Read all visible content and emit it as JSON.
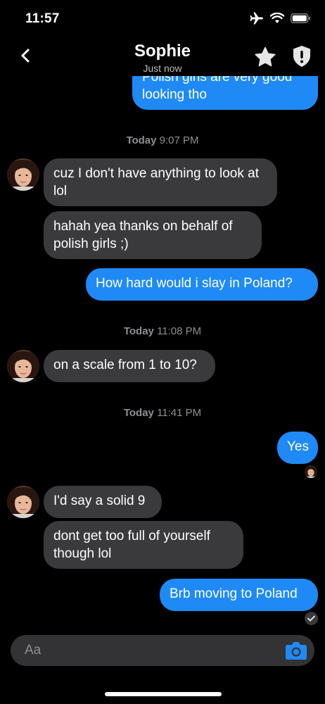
{
  "status_bar": {
    "time": "11:57"
  },
  "header": {
    "contact_name": "Sophie",
    "contact_status": "Just now"
  },
  "messages": [
    {
      "type": "outgoing",
      "text": "Polish girls are very good looking tho"
    },
    {
      "type": "timestamp",
      "day": "Today",
      "time": "9:07 PM"
    },
    {
      "type": "incoming",
      "text": "cuz I don't have anything to look at lol"
    },
    {
      "type": "incoming",
      "text": "hahah yea thanks on behalf of polish girls ;)"
    },
    {
      "type": "outgoing",
      "text": "How hard would i slay in Poland?"
    },
    {
      "type": "timestamp",
      "day": "Today",
      "time": "11:08 PM"
    },
    {
      "type": "incoming",
      "text": "on a scale from 1 to 10?"
    },
    {
      "type": "timestamp",
      "day": "Today",
      "time": "11:41 PM"
    },
    {
      "type": "outgoing",
      "text": "Yes"
    },
    {
      "type": "incoming",
      "text": "I'd say a solid 9"
    },
    {
      "type": "incoming",
      "text": "dont get too full of yourself though lol"
    },
    {
      "type": "outgoing",
      "text": "Brb moving to Poland"
    }
  ],
  "composer": {
    "placeholder": "Aa"
  },
  "colors": {
    "outgoing_bubble": "#1f8af6",
    "incoming_bubble": "#3a3a3c",
    "background": "#000000"
  },
  "icons": [
    "back-chevron-icon",
    "star-icon",
    "shield-icon",
    "camera-icon",
    "airplane-icon",
    "wifi-icon",
    "battery-icon",
    "checkmark-icon"
  ]
}
